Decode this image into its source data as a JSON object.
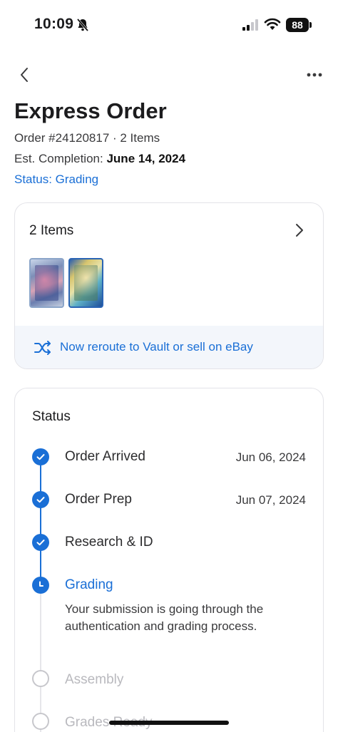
{
  "status_bar": {
    "time": "10:09",
    "battery": "88",
    "icons": [
      "bell-slash-icon",
      "cellular-signal-icon",
      "wifi-icon",
      "battery-icon"
    ]
  },
  "nav": {
    "back_icon": "chevron-left-icon",
    "more_icon": "more-horizontal-icon"
  },
  "header": {
    "title": "Express Order",
    "order_line": "Order #24120817 · 2 Items",
    "est_label": "Est. Completion:",
    "est_date": "June 14, 2024",
    "status": "Status: Grading"
  },
  "items_card": {
    "title": "2 Items",
    "chevron_icon": "chevron-right-icon",
    "thumbnails": [
      "card-thumbnail-1",
      "card-thumbnail-2"
    ],
    "reroute_icon": "shuffle-icon",
    "reroute_text": "Now reroute to Vault or sell on eBay"
  },
  "status_card": {
    "title": "Status",
    "steps": [
      {
        "label": "Order Arrived",
        "date": "Jun 06, 2024",
        "state": "done"
      },
      {
        "label": "Order Prep",
        "date": "Jun 07, 2024",
        "state": "done"
      },
      {
        "label": "Research & ID",
        "date": "",
        "state": "done"
      },
      {
        "label": "Grading",
        "date": "",
        "state": "current",
        "description": "Your submission is going through the authentication and grading process."
      },
      {
        "label": "Assembly",
        "date": "",
        "state": "todo"
      },
      {
        "label": "Grades Ready",
        "date": "",
        "state": "todo"
      }
    ]
  },
  "colors": {
    "accent": "#1a6fd6",
    "muted": "#b9b9be",
    "card_border": "#e3e3e8",
    "banner_bg": "#f3f6fb"
  }
}
